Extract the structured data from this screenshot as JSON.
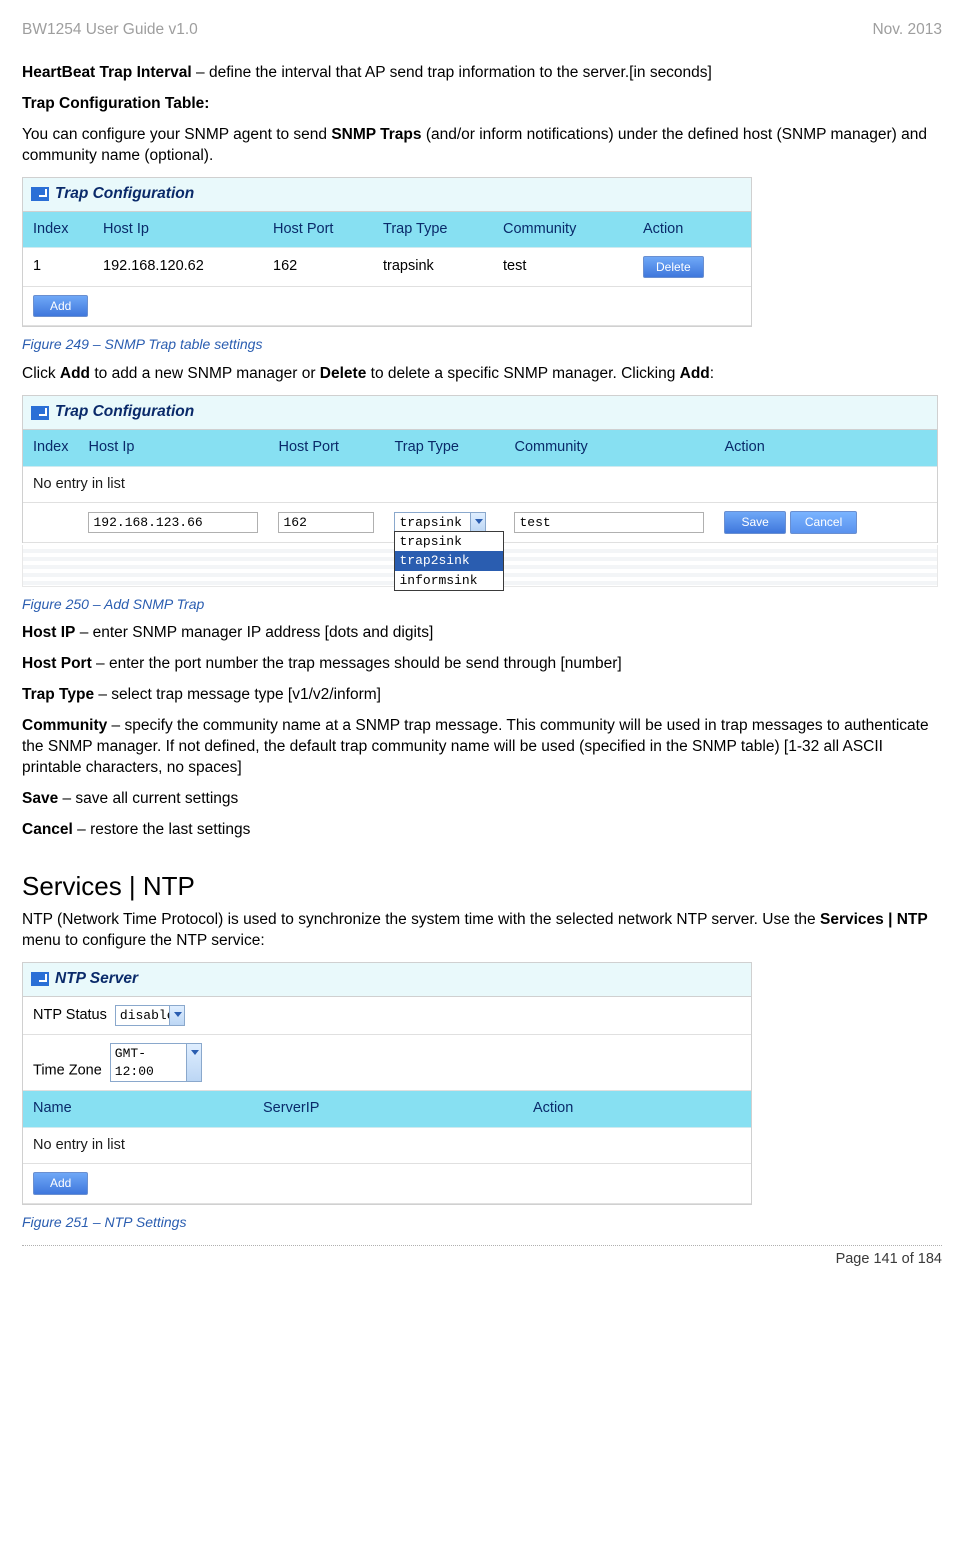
{
  "header": {
    "left": "BW1254 User Guide v1.0",
    "right": "Nov.  2013"
  },
  "p_heartbeat_b": "HeartBeat Trap Interval",
  "p_heartbeat_rest": " – define the interval that AP send trap information to the server.[in seconds]",
  "p_trapconf_title": "Trap Configuration Table:",
  "p_trapconf_body1": "You can configure your SNMP agent to send ",
  "p_trapconf_bold": "SNMP Traps",
  "p_trapconf_body2": " (and/or inform notifications) under the defined host (SNMP manager) and community name (optional).",
  "fig249": "Figure 249 – SNMP Trap table settings",
  "p_click_1": "Click ",
  "p_click_addb": "Add",
  "p_click_2": " to add a new SNMP manager or ",
  "p_click_delb": "Delete",
  "p_click_3": " to delete a specific SNMP manager. Clicking ",
  "p_click_addb2": "Add",
  "p_click_4": ":",
  "fig250": "Figure 250 – Add SNMP Trap",
  "defs": {
    "hostip_b": "Host IP",
    "hostip_t": " – enter SNMP manager IP address [dots and digits]",
    "hostport_b": "Host Port",
    "hostport_t": " – enter the port number the trap messages should be send through [number]",
    "traptype_b": "Trap Type",
    "traptype_t": " – select trap message type [v1/v2/inform]",
    "comm_b": "Community",
    "comm_t": " – specify the community name at a SNMP trap message. This community will be used in trap messages to authenticate the SNMP manager. If not defined, the default trap community name will be used (specified in the SNMP table) [1-32 all ASCII printable characters, no spaces]",
    "save_b": "Save",
    "save_t": " – save all current settings",
    "cancel_b": "Cancel",
    "cancel_t": " – restore the last settings"
  },
  "sec_ntp_title": "Services | NTP",
  "ntp_intro_1": "NTP (Network Time Protocol) is used to synchronize the system time with the selected network NTP server. Use the ",
  "ntp_intro_b": "Services | NTP",
  "ntp_intro_2": " menu to configure the NTP service:",
  "fig251": "Figure 251 – NTP Settings",
  "footer": "Page 141 of 184",
  "trap_panel_title": "Trap Configuration",
  "trap_headers": {
    "index": "Index",
    "hostip": "Host Ip",
    "hostport": "Host Port",
    "traptype": "Trap Type",
    "comm": "Community",
    "action": "Action"
  },
  "trap_row": {
    "index": "1",
    "hostip": "192.168.120.62",
    "hostport": "162",
    "traptype": "trapsink",
    "comm": "test"
  },
  "btn_delete": "Delete",
  "btn_add": "Add",
  "btn_save": "Save",
  "btn_cancel": "Cancel",
  "trap2_noentry": "No entry in list",
  "trap2_inputs": {
    "hostip": "192.168.123.66",
    "hostport": "162",
    "comm": "test",
    "sel": "trapsink"
  },
  "trap2_dd": {
    "o1": "trapsink",
    "o2": "trap2sink",
    "o3": "informsink"
  },
  "ntp_panel_title": "NTP Server",
  "ntp_status_label": "NTP Status",
  "ntp_status_val": "disable",
  "ntp_tz_label": "Time Zone",
  "ntp_tz_val": "GMT-12:00",
  "ntp_headers": {
    "name": "Name",
    "serverip": "ServerIP",
    "action": "Action"
  },
  "ntp_noentry": "No entry in list"
}
